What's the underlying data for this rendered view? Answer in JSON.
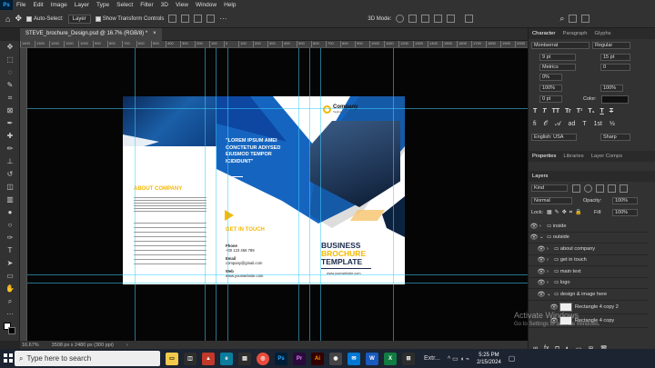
{
  "menubar": {
    "app_logo": "Ps",
    "items": [
      "File",
      "Edit",
      "Image",
      "Layer",
      "Type",
      "Select",
      "Filter",
      "3D",
      "View",
      "Window",
      "Help"
    ]
  },
  "options": {
    "auto_select": "Auto-Select:",
    "layer_select": "Layer",
    "show_transform": "Show Transform Controls",
    "mode_3d": "3D Mode:"
  },
  "document": {
    "tab_title": "STEVE_brochure_Design.psd @ 16.7% (RGB/8) *",
    "close": "×"
  },
  "ruler_ticks": [
    "1400",
    "1300",
    "1200",
    "1100",
    "1000",
    "900",
    "800",
    "700",
    "600",
    "500",
    "400",
    "300",
    "200",
    "100",
    "0",
    "100",
    "200",
    "300",
    "400",
    "500",
    "600",
    "700",
    "800",
    "900",
    "1000",
    "1100",
    "1200",
    "1300",
    "1400",
    "1500",
    "1600",
    "1700",
    "1800",
    "1900",
    "2000"
  ],
  "brochure": {
    "left_heading": "ABOUT COMPANY",
    "quote": "\"LOREM IPSUM AMEI CONCTETUR ADIYSED EIUSMOD TEMPOR ICIDIDUNT\"",
    "get_in_touch": "GET IN TOUCH",
    "phone_label": "Phone",
    "phone_value": "+00 123 456 789",
    "email_label": "Email",
    "email_value": "company@gmail.com",
    "web_label": "Web",
    "web_value": "www.yourwebsite.com",
    "company_name": "Company",
    "company_tag": "Tagline here",
    "title_line1": "BUSINESS",
    "title_line2": "BROCHURE",
    "title_line3": "TEMPLATE",
    "footer_url": "www.yourwebsite.com",
    "accent_blue": "#1a6fc0",
    "accent_yellow": "#f5b800"
  },
  "status": {
    "zoom": "16.67%",
    "doc_size": "3508 px x 2480 px (300 ppi)"
  },
  "character_panel": {
    "tabs": [
      "Character",
      "Paragraph",
      "Glyphs"
    ],
    "font_family": "Montserrat",
    "font_style": "Regular",
    "font_size": "9 pt",
    "leading": "15 pt",
    "kerning": "Metrics",
    "tracking": "0",
    "vscale": "0%",
    "hscale_a": "100%",
    "hscale_b": "100%",
    "baseline": "0 pt",
    "color_label": "Color:",
    "style_buttons": [
      "T",
      "T",
      "TT",
      "Tr",
      "T¹",
      "T₁",
      "T",
      "T"
    ],
    "language": "English: USA",
    "antialias": "Sharp"
  },
  "properties_tabs": [
    "Properties",
    "Libraries",
    "Layer Comps"
  ],
  "layers_panel": {
    "title": "Layers",
    "kind": "Kind",
    "blend_mode": "Normal",
    "opacity_label": "Opacity:",
    "opacity": "100%",
    "lock_label": "Lock:",
    "fill_label": "Fill:",
    "fill": "100%",
    "layers": [
      "inside",
      "outside",
      "about company",
      "get in touch",
      "main text",
      "logo",
      "design & image here",
      "Rectangle 4 copy 2",
      "Rectangle 4 copy"
    ]
  },
  "activation": {
    "line1": "Activate Windows",
    "line2": "Go to Settings to activate Windows."
  },
  "taskbar": {
    "search_placeholder": "Type here to search",
    "apps": [
      "Ps",
      "Pr",
      "Ai",
      "W",
      "X"
    ],
    "tray_text": "Extr...",
    "time": "5:25 PM",
    "date": "2/15/2024"
  }
}
